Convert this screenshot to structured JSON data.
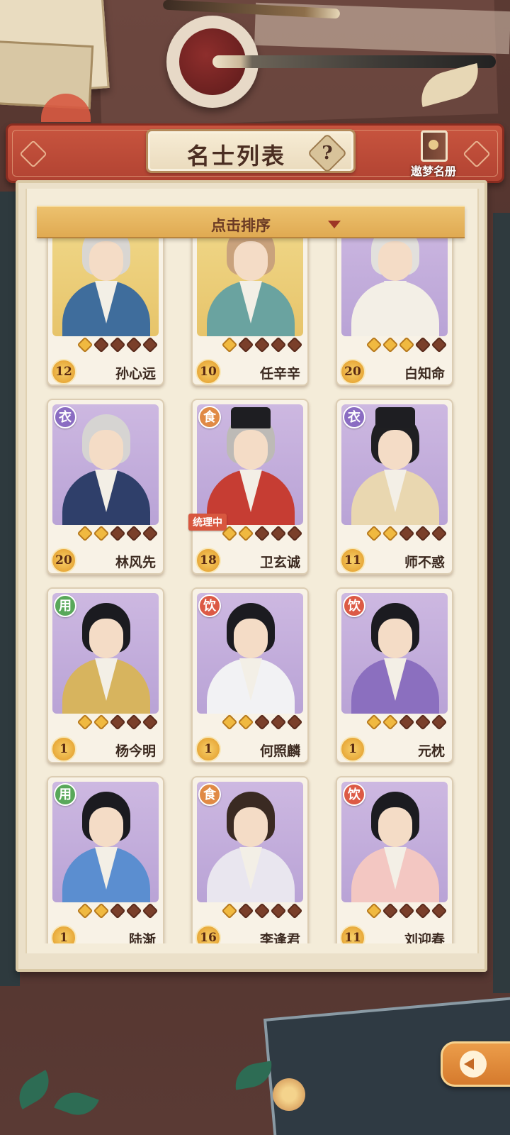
{
  "header": {
    "title": "名士列表",
    "help_icon_label": "?",
    "book_label": "遨梦名册"
  },
  "sort": {
    "label": "点击排序"
  },
  "colors": {
    "header_red": "#b24332",
    "sort_bar_gold": "#e0aa52",
    "clothes_badge": "#8a6cc2",
    "food_badge": "#e08a45",
    "use_badge": "#59a85a",
    "drink_badge": "#dc5a45"
  },
  "cards": [
    {
      "name": "孙心远",
      "level": "12",
      "stars": 1,
      "badge": "",
      "badge_type": "",
      "status": "",
      "portrait": "gold"
    },
    {
      "name": "任辛辛",
      "level": "10",
      "stars": 1,
      "badge": "",
      "badge_type": "",
      "status": "",
      "portrait": "gold"
    },
    {
      "name": "白知命",
      "level": "20",
      "stars": 3,
      "badge": "",
      "badge_type": "",
      "status": "",
      "portrait": "purple"
    },
    {
      "name": "林风先",
      "level": "20",
      "stars": 2,
      "badge": "衣",
      "badge_type": "clothes",
      "status": "",
      "portrait": "purple"
    },
    {
      "name": "卫玄诚",
      "level": "18",
      "stars": 2,
      "badge": "食",
      "badge_type": "food",
      "status": "统理中",
      "portrait": "purple"
    },
    {
      "name": "师不惑",
      "level": "11",
      "stars": 2,
      "badge": "衣",
      "badge_type": "clothes",
      "status": "",
      "portrait": "purple"
    },
    {
      "name": "杨今明",
      "level": "1",
      "stars": 2,
      "badge": "用",
      "badge_type": "use",
      "status": "",
      "portrait": "purple"
    },
    {
      "name": "何照麟",
      "level": "1",
      "stars": 2,
      "badge": "饮",
      "badge_type": "drink",
      "status": "",
      "portrait": "purple"
    },
    {
      "name": "元枕",
      "level": "1",
      "stars": 2,
      "badge": "饮",
      "badge_type": "drink",
      "status": "",
      "portrait": "purple"
    },
    {
      "name": "陆渐",
      "level": "1",
      "stars": 2,
      "badge": "用",
      "badge_type": "use",
      "status": "",
      "portrait": "purple"
    },
    {
      "name": "李逢君",
      "level": "16",
      "stars": 1,
      "badge": "食",
      "badge_type": "food",
      "status": "",
      "portrait": "purple"
    },
    {
      "name": "刘迎春",
      "level": "11",
      "stars": 1,
      "badge": "饮",
      "badge_type": "drink",
      "status": "",
      "portrait": "purple"
    }
  ],
  "max_stars": 5
}
